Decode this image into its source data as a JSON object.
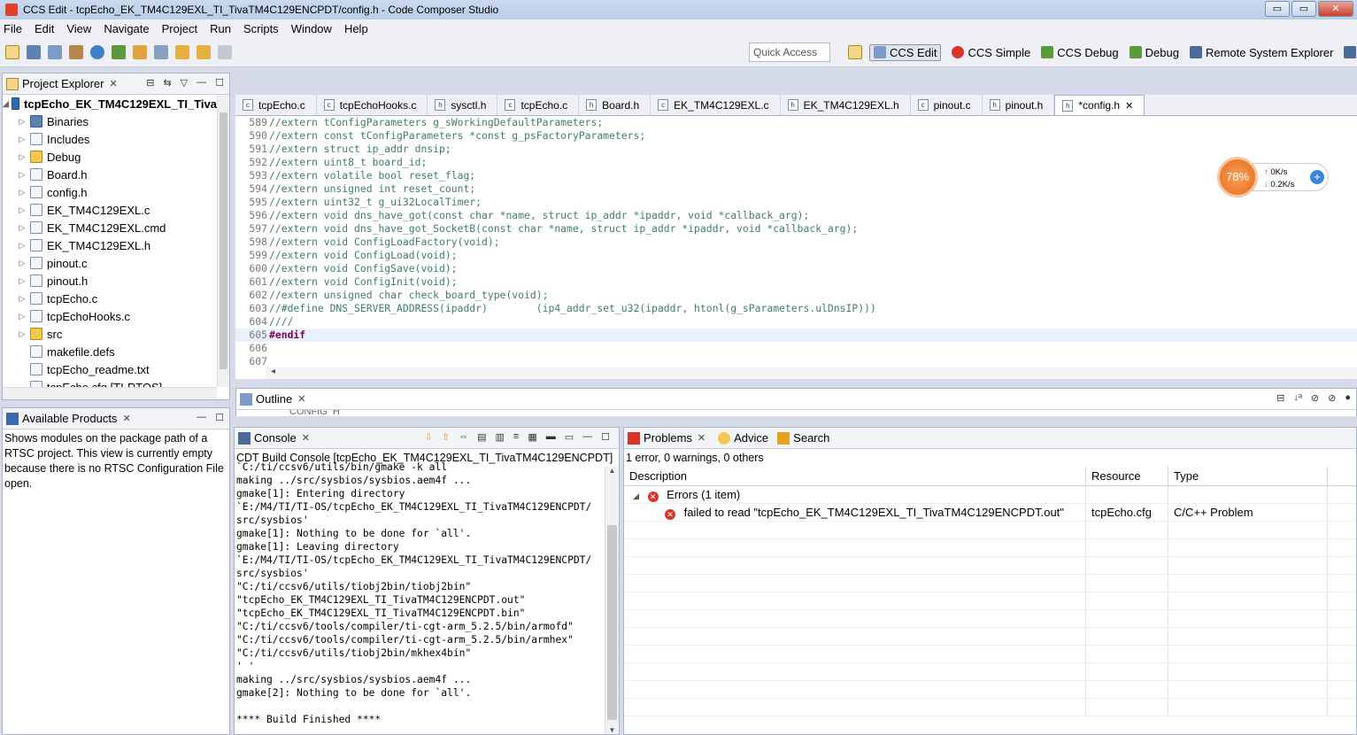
{
  "window": {
    "title": "CCS Edit - tcpEcho_EK_TM4C129EXL_TI_TivaTM4C129ENCPDT/config.h - Code Composer Studio",
    "buttons": {
      "minimize": "▭",
      "maximize": "▭",
      "close": "✕"
    }
  },
  "menu": [
    "File",
    "Edit",
    "View",
    "Navigate",
    "Project",
    "Run",
    "Scripts",
    "Window",
    "Help"
  ],
  "toolbar": {
    "quick_access_placeholder": "Quick Access",
    "perspectives": [
      "CCS Edit",
      "CCS Simple",
      "CCS Debug",
      "Debug",
      "Remote System Explorer",
      "R"
    ]
  },
  "project_explorer": {
    "title": "Project Explorer",
    "root": "tcpEcho_EK_TM4C129EXL_TI_Tiva",
    "items": [
      {
        "label": "Binaries"
      },
      {
        "label": "Includes"
      },
      {
        "label": "Debug"
      },
      {
        "label": "Board.h"
      },
      {
        "label": "config.h"
      },
      {
        "label": "EK_TM4C129EXL.c"
      },
      {
        "label": "EK_TM4C129EXL.cmd"
      },
      {
        "label": "EK_TM4C129EXL.h"
      },
      {
        "label": "pinout.c"
      },
      {
        "label": "pinout.h"
      },
      {
        "label": "tcpEcho.c"
      },
      {
        "label": "tcpEchoHooks.c"
      },
      {
        "label": "src"
      },
      {
        "label": "makefile.defs"
      },
      {
        "label": "tcpEcho_readme.txt"
      },
      {
        "label": "tcpEcho.cfg [TI-RTOS]"
      }
    ]
  },
  "available_products": {
    "title": "Available Products",
    "message": "Shows modules on the package path of a RTSC project. This view is currently empty because there is no RTSC Configuration File open."
  },
  "editor": {
    "tabs": [
      {
        "label": "tcpEcho.c",
        "icon": "c"
      },
      {
        "label": "tcpEchoHooks.c",
        "icon": "c"
      },
      {
        "label": "sysctl.h",
        "icon": "h"
      },
      {
        "label": "tcpEcho.c",
        "icon": "c"
      },
      {
        "label": "Board.h",
        "icon": "h"
      },
      {
        "label": "EK_TM4C129EXL.c",
        "icon": "c"
      },
      {
        "label": "EK_TM4C129EXL.h",
        "icon": "h"
      },
      {
        "label": "pinout.c",
        "icon": "c"
      },
      {
        "label": "pinout.h",
        "icon": "h"
      },
      {
        "label": "*config.h",
        "icon": "h"
      }
    ],
    "lines": [
      {
        "n": "589",
        "text": "//extern tConfigParameters g_sWorkingDefaultParameters;"
      },
      {
        "n": "590",
        "text": "//extern const tConfigParameters *const g_psFactoryParameters;"
      },
      {
        "n": "591",
        "text": "//extern struct ip_addr dnsip;"
      },
      {
        "n": "592",
        "text": "//extern uint8_t board_id;"
      },
      {
        "n": "593",
        "text": "//extern volatile bool reset_flag;"
      },
      {
        "n": "594",
        "text": "//extern unsigned int reset_count;"
      },
      {
        "n": "595",
        "text": "//extern uint32_t g_ui32LocalTimer;"
      },
      {
        "n": "596",
        "text": "//extern void dns_have_got(const char *name, struct ip_addr *ipaddr, void *callback_arg);"
      },
      {
        "n": "597",
        "text": "//extern void dns_have_got_SocketB(const char *name, struct ip_addr *ipaddr, void *callback_arg);"
      },
      {
        "n": "598",
        "text": "//extern void ConfigLoadFactory(void);"
      },
      {
        "n": "599",
        "text": "//extern void ConfigLoad(void);"
      },
      {
        "n": "600",
        "text": "//extern void ConfigSave(void);"
      },
      {
        "n": "601",
        "text": "//extern void ConfigInit(void);"
      },
      {
        "n": "602",
        "text": "//extern unsigned char check_board_type(void);"
      },
      {
        "n": "603",
        "text": "//#define DNS_SERVER_ADDRESS(ipaddr)        (ip4_addr_set_u32(ipaddr, htonl(g_sParameters.ulDnsIP)))"
      },
      {
        "n": "604",
        "text": "////"
      },
      {
        "n": "605",
        "text": "#endif"
      },
      {
        "n": "606",
        "text": ""
      },
      {
        "n": "607",
        "text": ""
      }
    ]
  },
  "net_widget": {
    "percent": "78%",
    "up": "0K/s",
    "down": "0.2K/s",
    "plus": "+"
  },
  "outline": {
    "title": "Outline",
    "partial": "CONFIG_H"
  },
  "console": {
    "title": "Console",
    "subtitle": "CDT Build Console [tcpEcho_EK_TM4C129EXL_TI_TivaTM4C129ENCPDT]",
    "lines": [
      "`C:/ti/ccsv6/utils/bin/gmake -k all",
      "making ../src/sysbios/sysbios.aem4f ...",
      "gmake[1]: Entering directory",
      "`E:/M4/TI/TI-OS/tcpEcho_EK_TM4C129EXL_TI_TivaTM4C129ENCPDT/",
      "src/sysbios'",
      "gmake[1]: Nothing to be done for `all'.",
      "gmake[1]: Leaving directory",
      "`E:/M4/TI/TI-OS/tcpEcho_EK_TM4C129EXL_TI_TivaTM4C129ENCPDT/",
      "src/sysbios'",
      "\"C:/ti/ccsv6/utils/tiobj2bin/tiobj2bin\"",
      "\"tcpEcho_EK_TM4C129EXL_TI_TivaTM4C129ENCPDT.out\"",
      "\"tcpEcho_EK_TM4C129EXL_TI_TivaTM4C129ENCPDT.bin\"",
      "\"C:/ti/ccsv6/tools/compiler/ti-cgt-arm_5.2.5/bin/armofd\"",
      "\"C:/ti/ccsv6/tools/compiler/ti-cgt-arm_5.2.5/bin/armhex\"",
      "\"C:/ti/ccsv6/utils/tiobj2bin/mkhex4bin\"",
      "' '",
      "making ../src/sysbios/sysbios.aem4f ...",
      "gmake[2]: Nothing to be done for `all'.",
      "",
      "**** Build Finished ****"
    ]
  },
  "problems": {
    "tabs": [
      "Problems",
      "Advice",
      "Search"
    ],
    "summary": "1 error, 0 warnings, 0 others",
    "columns": [
      "Description",
      "Resource",
      "Type"
    ],
    "group": "Errors (1 item)",
    "rows": [
      {
        "description": "failed to read \"tcpEcho_EK_TM4C129EXL_TI_TivaTM4C129ENCPDT.out\"",
        "resource": "tcpEcho.cfg",
        "type": "C/C++ Problem"
      }
    ]
  }
}
